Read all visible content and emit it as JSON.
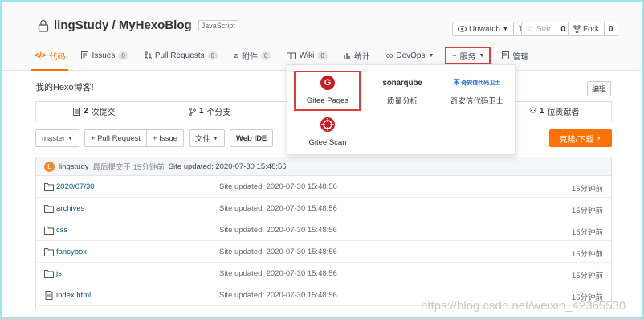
{
  "repo": {
    "owner_repo": "lingStudy / MyHexoBlog",
    "language": "JavaScript",
    "description": "我的Hexo博客!",
    "edit_label": "编辑"
  },
  "actions": {
    "watch_label": "Unwatch",
    "watch_count": "1",
    "star_label": "Star",
    "star_count": "0",
    "fork_label": "Fork",
    "fork_count": "0"
  },
  "tabs": {
    "code": "代码",
    "issues": "Issues",
    "issues_count": "0",
    "pull_requests": "Pull Requests",
    "pull_requests_count": "0",
    "attachments": "附件",
    "attachments_count": "0",
    "wiki": "Wiki",
    "wiki_count": "0",
    "stats": "统计",
    "devops": "DevOps",
    "services": "服务",
    "manage": "管理"
  },
  "services_menu": {
    "gitee_pages": "Gitee Pages",
    "sonarqube_logo": "sonarqube",
    "sonarqube": "质量分析",
    "qax_logo": "奇安信代码卫士",
    "qax": "奇安信代码卫士",
    "gitee_scan": "Gitee Scan"
  },
  "stats": {
    "commits_num": "2",
    "commits_label": "次提交",
    "branches_num": "1",
    "branches_label": "个分支",
    "contributors_num": "1",
    "contributors_label": "位贡献者"
  },
  "toolbar": {
    "branch": "master",
    "pull_request": "+ Pull Request",
    "issue": "+ Issue",
    "file": "文件",
    "web_ide": "Web IDE",
    "clone": "克隆/下载"
  },
  "last_commit": {
    "avatar_letter": "L",
    "author": "lingstudy",
    "meta": "最后提交于 15分钟前",
    "message": "Site updated: 2020-07-30 15:48:56"
  },
  "files": [
    {
      "name": "2020/07/30",
      "message": "Site updated: 2020-07-30 15:48:56",
      "time": "15分钟前",
      "type": "folder"
    },
    {
      "name": "archives",
      "message": "Site updated: 2020-07-30 15:48:56",
      "time": "15分钟前",
      "type": "folder"
    },
    {
      "name": "css",
      "message": "Site updated: 2020-07-30 15:48:56",
      "time": "15分钟前",
      "type": "folder"
    },
    {
      "name": "fancybox",
      "message": "Site updated: 2020-07-30 15:48:56",
      "time": "15分钟前",
      "type": "folder"
    },
    {
      "name": "js",
      "message": "Site updated: 2020-07-30 15:48:56",
      "time": "15分钟前",
      "type": "folder"
    },
    {
      "name": "index.html",
      "message": "Site updated: 2020-07-30 15:48:56",
      "time": "15分钟前",
      "type": "file"
    }
  ],
  "watermark": "https://blog.csdn.net/weixin_42365530",
  "colors": {
    "accent": "#fe7300",
    "highlight": "#e23a3a",
    "link": "#005980",
    "gitee_red": "#c71d23"
  }
}
